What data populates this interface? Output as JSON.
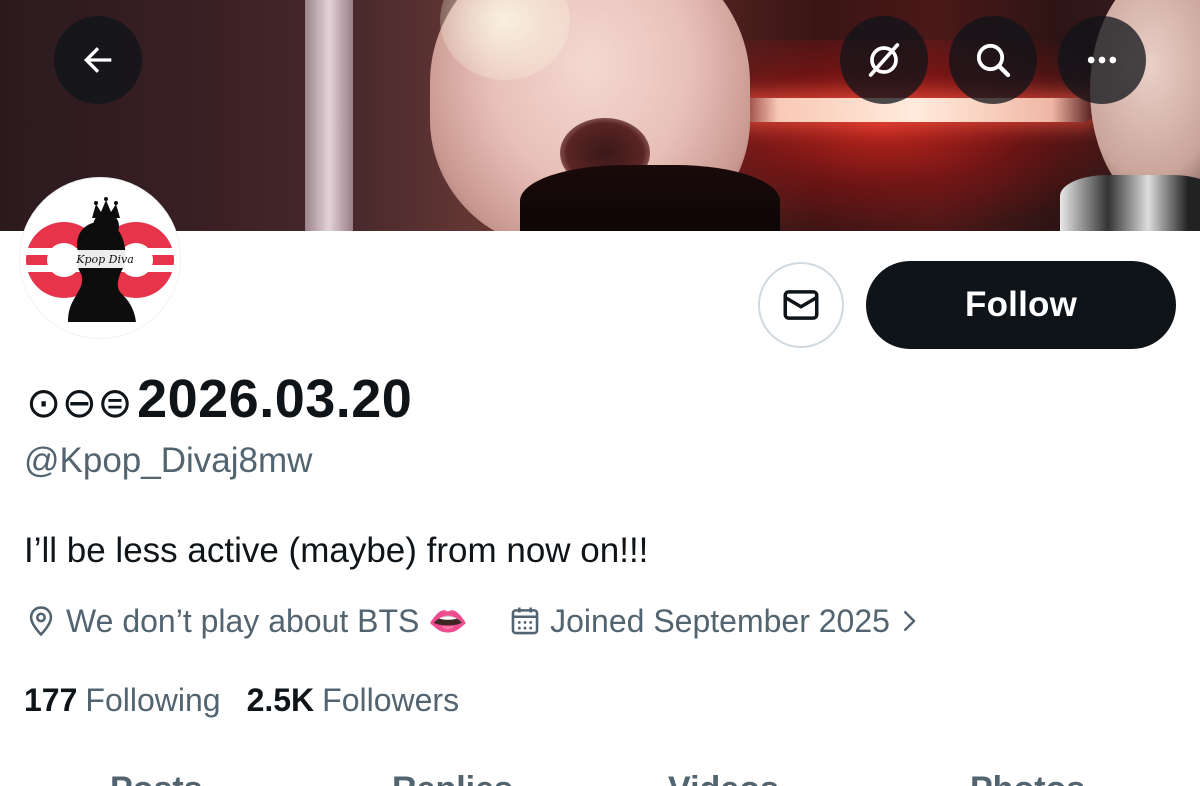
{
  "header": {
    "back_icon": "arrow-left-icon",
    "grok_icon": "grok-icon",
    "search_icon": "search-icon",
    "more_icon": "more-horizontal-icon"
  },
  "avatar": {
    "logo_text": "Kpop Diva"
  },
  "actions": {
    "message_icon": "mail-icon",
    "follow_label": "Follow"
  },
  "profile": {
    "display_name_glyphs": "⊙⊖⊜",
    "display_name": "2026.03.20",
    "handle": "@Kpop_Divaj8mw",
    "bio": "I’ll be less active (maybe) from now on!!!",
    "location": "We don’t play about BTS 👄",
    "joined": "Joined September 2025"
  },
  "stats": {
    "following_count": "177",
    "following_label": "Following",
    "followers_count": "2.5K",
    "followers_label": "Followers"
  },
  "tabs": [
    "Posts",
    "Replies",
    "Videos",
    "Photos"
  ],
  "colors": {
    "text_primary": "#0f1419",
    "text_secondary": "#536471",
    "follow_button_bg": "#0f1419",
    "border": "#cfd9de"
  }
}
